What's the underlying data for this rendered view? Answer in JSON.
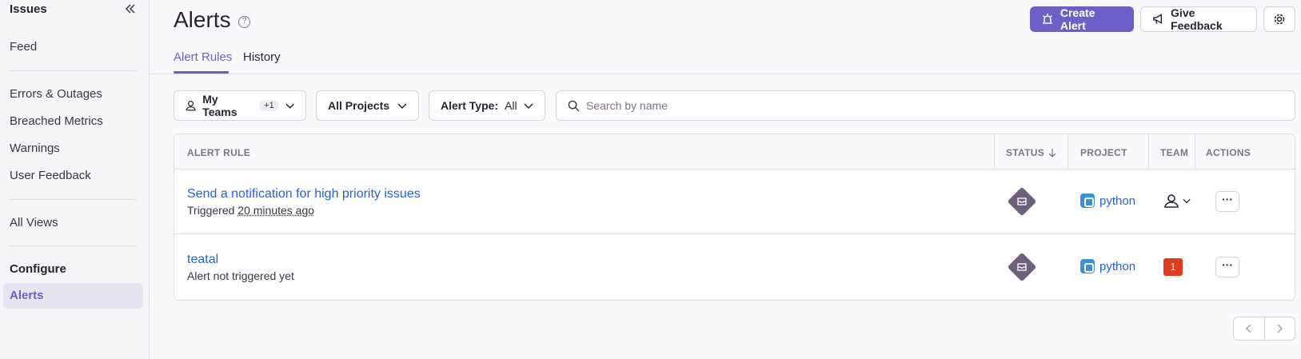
{
  "sidebar": {
    "header": "Issues",
    "items_top": [
      "Feed"
    ],
    "items_mid": [
      "Errors & Outages",
      "Breached Metrics",
      "Warnings",
      "User Feedback"
    ],
    "items_views": [
      "All Views"
    ],
    "configure_label": "Configure",
    "active_item": "Alerts"
  },
  "header": {
    "title": "Alerts",
    "help_glyph": "?",
    "create_alert_label": "Create Alert",
    "feedback_label": "Give Feedback",
    "tabs": [
      {
        "label": "Alert Rules",
        "active": true
      },
      {
        "label": "History",
        "active": false
      }
    ]
  },
  "filters": {
    "teams_label": "My Teams",
    "teams_badge": "+1",
    "projects_label": "All Projects",
    "alert_type_label": "Alert Type:",
    "alert_type_value": "All",
    "search_placeholder": "Search by name"
  },
  "table": {
    "columns": [
      "ALERT RULE",
      "STATUS",
      "PROJECT",
      "TEAM",
      "ACTIONS"
    ],
    "rows": [
      {
        "title": "Send a notification for high priority issues",
        "subtitle_prefix": "Triggered ",
        "subtitle_time": "20 minutes ago",
        "status_icon": "archive-diamond-icon",
        "project": "python",
        "team": "user-icon",
        "actions": "···"
      },
      {
        "title": "teatal",
        "subtitle_prefix": "Alert not triggered yet",
        "subtitle_time": "",
        "status_icon": "archive-diamond-icon",
        "project": "python",
        "team": "1",
        "actions": "···"
      }
    ]
  },
  "colors": {
    "accent": "#6c5fc7",
    "link": "#2562d4",
    "team_badge": "#e03a1f"
  }
}
